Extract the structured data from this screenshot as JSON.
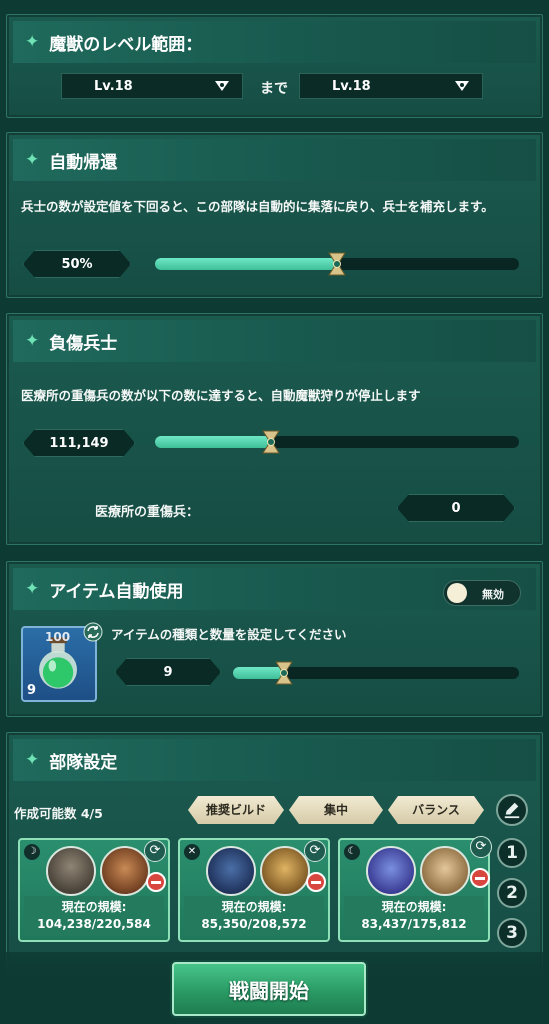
{
  "level_range": {
    "title": "魔獣のレベル範囲：",
    "from": "Lv.18",
    "until_label": "まで",
    "to": "Lv.18"
  },
  "auto_return": {
    "title": "自動帰還",
    "description": "兵士の数が設定値を下回ると、この部隊は自動的に集落に戻り、兵士を補充します。",
    "value_label": "50%",
    "value_percent": 50
  },
  "wounded": {
    "title": "負傷兵士",
    "description": "医療所の重傷兵の数が以下の数に達すると、自動魔獣狩りが停止します",
    "threshold": "111,149",
    "slider_fraction": 0.32,
    "hospital_label": "医療所の重傷兵：",
    "hospital_count": "0"
  },
  "auto_item": {
    "title": "アイテム自動使用",
    "toggle_label": "無効",
    "item_badge": "100",
    "item_count": "9",
    "description": "アイテムの種類と数量を設定してください",
    "quantity": "9",
    "slider_fraction": 0.18
  },
  "troops": {
    "title": "部隊設定",
    "available_label": "作成可能数 4/5",
    "builds": [
      "推奨ビルド",
      "集中",
      "バランス"
    ],
    "scale_label": "現在の規模:",
    "cards": [
      {
        "scale": "104,238/220,584"
      },
      {
        "scale": "85,350/208,572"
      },
      {
        "scale": "83,437/175,812"
      }
    ],
    "slots": [
      "1",
      "2",
      "3"
    ]
  },
  "start_button": "戦闘開始",
  "colors": {
    "background": "#0d3b34",
    "accent": "#6fe3b5",
    "slider_fill": "#4fd3ab",
    "card": "#2a8f6e",
    "button": "#2fa06e"
  }
}
